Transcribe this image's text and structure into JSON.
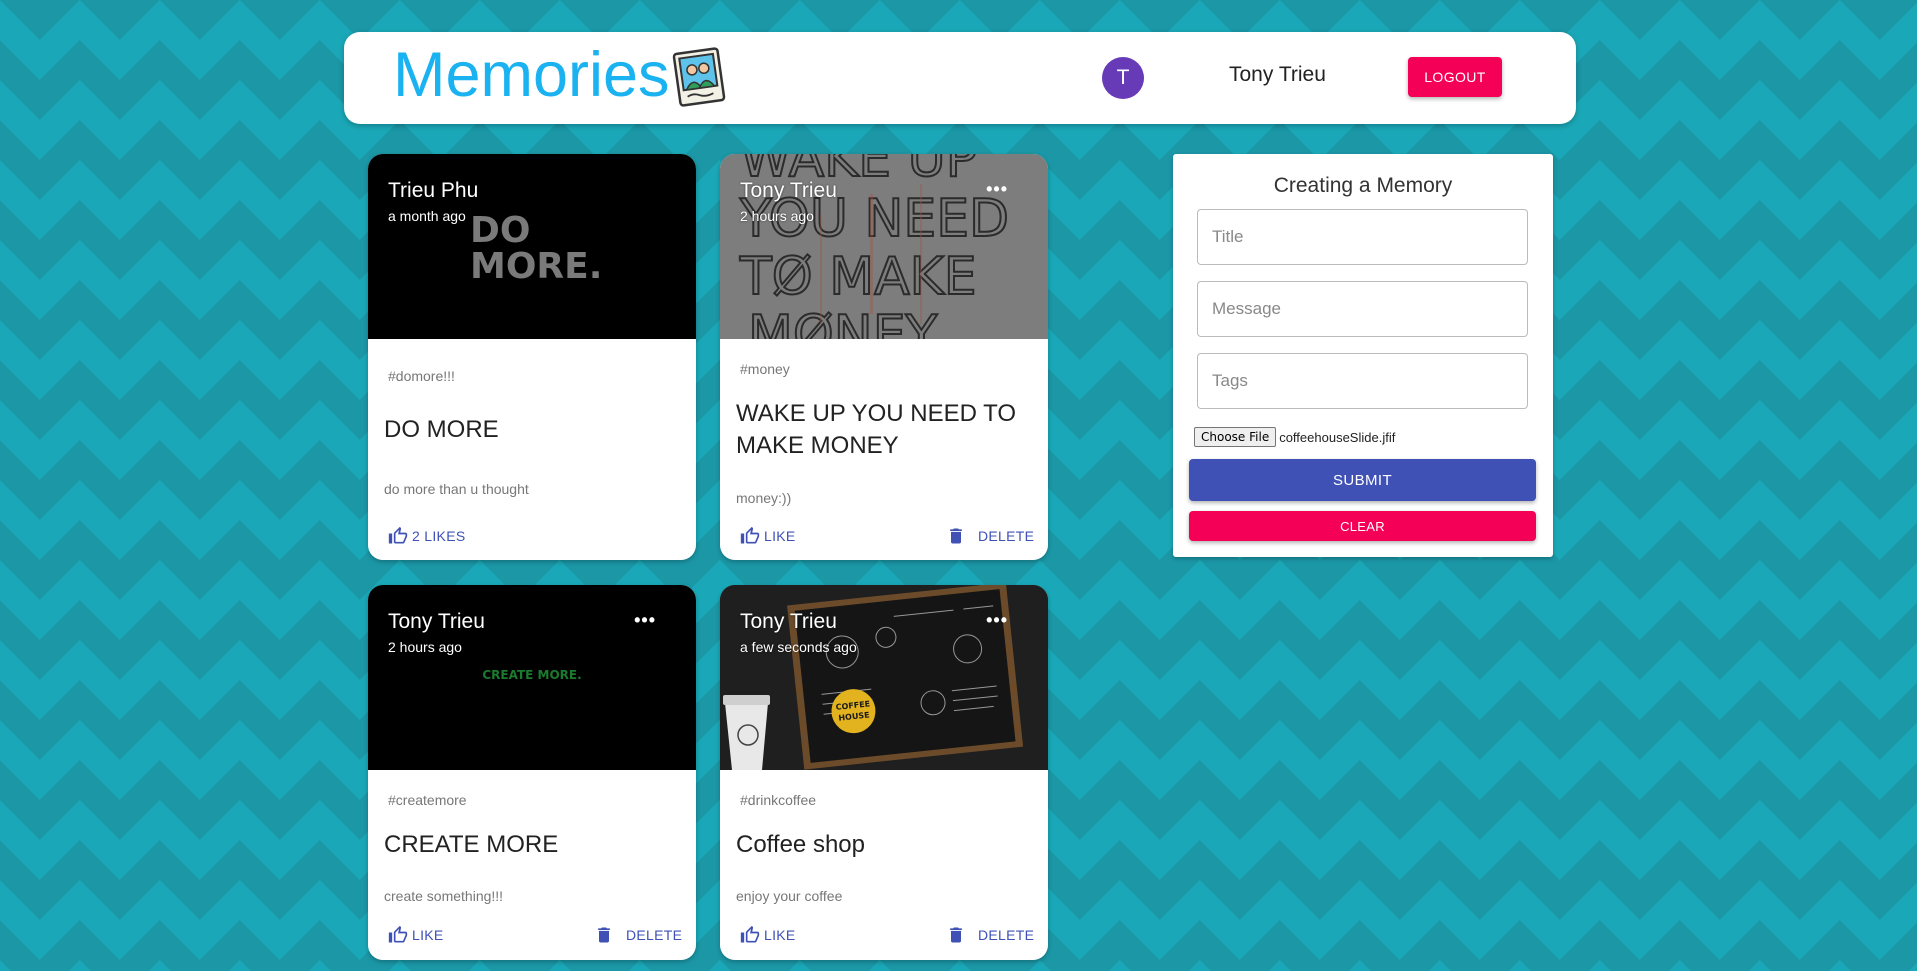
{
  "header": {
    "brand": "Memories",
    "brand_icon": "photo-memories-icon",
    "avatar_letter": "T",
    "username": "Tony Trieu",
    "logout_label": "LOGOUT",
    "colors": {
      "brand": "#1ab2f0",
      "avatar": "#673ab7",
      "logout": "#f50057"
    }
  },
  "posts": [
    {
      "author": "Trieu Phu",
      "time": "a month ago",
      "media_text": "DO MORE.",
      "tags": "#domore!!!",
      "title": "DO MORE",
      "message": "do more than u thought",
      "like_label": "2 LIKES",
      "like_icon": "thumb-up-icon"
    },
    {
      "author": "Tony Trieu",
      "time": "2 hours ago",
      "media_text": "WAKE UP YOU NEED TØ MAKE MØNEY",
      "more_icon": "more-horiz-icon",
      "tags": "#money",
      "title": "WAKE UP YOU NEED TO MAKE MONEY",
      "message": "money:))",
      "like_label": "LIKE",
      "delete_label": "DELETE"
    },
    {
      "author": "Tony Trieu",
      "time": "2 hours ago",
      "media_text": "CREATE MORE.",
      "more_icon": "more-horiz-icon",
      "tags": "#createmore",
      "title": "CREATE MORE",
      "message": "create something!!!",
      "like_label": "LIKE",
      "delete_label": "DELETE"
    },
    {
      "author": "Tony Trieu",
      "time": "a few seconds ago",
      "media_text": "COFFEE HOUSE",
      "more_icon": "more-horiz-icon",
      "tags": "#drinkcoffee",
      "title": "Coffee shop",
      "message": "enjoy your coffee",
      "like_label": "LIKE",
      "delete_label": "DELETE"
    }
  ],
  "form": {
    "title": "Creating a Memory",
    "title_placeholder": "Title",
    "message_placeholder": "Message",
    "tags_placeholder": "Tags",
    "file_button": "Choose File",
    "file_name": "coffeehouseSlide.jfif",
    "submit_label": "SUBMIT",
    "clear_label": "CLEAR",
    "colors": {
      "submit": "#3f51b5",
      "clear": "#f50057"
    }
  }
}
